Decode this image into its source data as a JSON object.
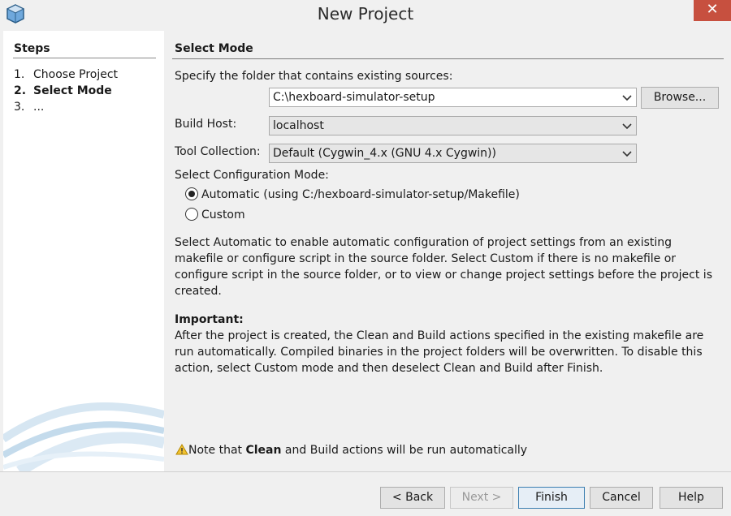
{
  "window": {
    "title": "New Project",
    "close_glyph": "✕"
  },
  "steps": {
    "title": "Steps",
    "items": [
      {
        "num": "1.",
        "label": "Choose Project"
      },
      {
        "num": "2.",
        "label": "Select Mode"
      },
      {
        "num": "3.",
        "label": "..."
      }
    ]
  },
  "main": {
    "heading": "Select Mode",
    "folder_label": "Specify the folder that contains existing sources:",
    "folder_value": "C:\\hexboard-simulator-setup",
    "browse_label": "Browse...",
    "build_host_label": "Build Host:",
    "build_host_value": "localhost",
    "tool_collection_label": "Tool Collection:",
    "tool_collection_value": "Default (Cygwin_4.x (GNU 4.x Cygwin))",
    "config_mode_label": "Select Configuration Mode:",
    "radio_automatic": "Automatic (using C:/hexboard-simulator-setup/Makefile)",
    "radio_custom": "Custom",
    "description": "Select Automatic to enable automatic configuration of project settings from an existing makefile or configure script in the source folder. Select Custom if there is no makefile or configure script in the source folder, or to view or change project settings before the project is created.",
    "important_title": "Important:",
    "important_text": "After the project is created, the Clean and Build actions specified in the existing makefile are run automatically. Compiled binaries in the project folders will be overwritten. To disable this action, select Custom mode and then deselect Clean and Build after Finish.",
    "note_prefix": "Note that ",
    "note_bold": "Clean",
    "note_suffix": " and Build actions will be run automatically"
  },
  "footer": {
    "back": "< Back",
    "next": "Next >",
    "finish": "Finish",
    "cancel": "Cancel",
    "help": "Help"
  },
  "colors": {
    "close": "#c7503f",
    "accent": "#3c7fb1"
  },
  "icons": [
    "netbeans-cube-icon",
    "close-icon",
    "chevron-down-icon",
    "warning-icon"
  ]
}
